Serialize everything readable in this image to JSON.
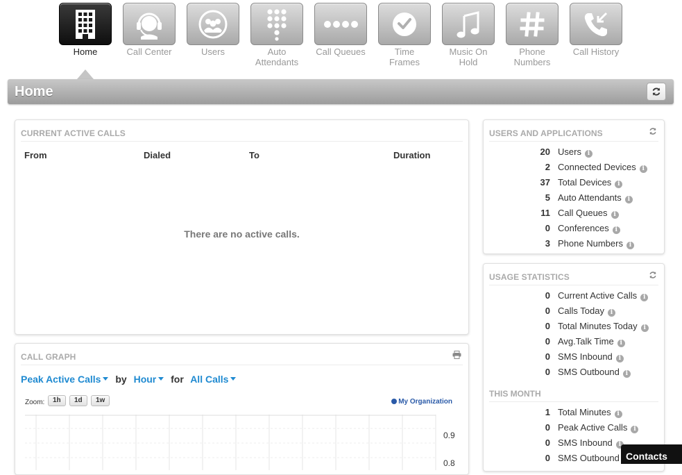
{
  "nav": {
    "items": [
      {
        "label": "Home",
        "icon": "building-icon",
        "active": true
      },
      {
        "label": "Call Center",
        "icon": "headset-icon",
        "active": false
      },
      {
        "label": "Users",
        "icon": "users-icon",
        "active": false
      },
      {
        "label": "Auto Attendants",
        "icon": "keypad-icon",
        "active": false
      },
      {
        "label": "Call Queues",
        "icon": "queue-dots-icon",
        "active": false
      },
      {
        "label": "Time Frames",
        "icon": "clock-icon",
        "active": false
      },
      {
        "label": "Music On Hold",
        "icon": "music-note-icon",
        "active": false
      },
      {
        "label": "Phone Numbers",
        "icon": "hash-icon",
        "active": false
      },
      {
        "label": "Call History",
        "icon": "phone-history-icon",
        "active": false
      }
    ]
  },
  "header": {
    "title": "Home",
    "refresh_icon": "refresh-icon"
  },
  "active_calls": {
    "title": "CURRENT ACTIVE CALLS",
    "columns": [
      "From",
      "Dialed",
      "To",
      "Duration"
    ],
    "empty_message": "There are no active calls."
  },
  "users_apps": {
    "title": "USERS AND APPLICATIONS",
    "rows": [
      {
        "value": "20",
        "label": "Users"
      },
      {
        "value": "2",
        "label": "Connected Devices"
      },
      {
        "value": "37",
        "label": "Total Devices"
      },
      {
        "value": "5",
        "label": "Auto Attendants"
      },
      {
        "value": "11",
        "label": "Call Queues"
      },
      {
        "value": "0",
        "label": "Conferences"
      },
      {
        "value": "3",
        "label": "Phone Numbers"
      }
    ]
  },
  "usage": {
    "title": "USAGE STATISTICS",
    "rows": [
      {
        "value": "0",
        "label": "Current Active Calls"
      },
      {
        "value": "0",
        "label": "Calls Today"
      },
      {
        "value": "0",
        "label": "Total Minutes Today"
      },
      {
        "value": "0",
        "label": "Avg.Talk Time"
      },
      {
        "value": "0",
        "label": "SMS Inbound"
      },
      {
        "value": "0",
        "label": "SMS Outbound"
      }
    ],
    "month_title": "THIS MONTH",
    "month_rows": [
      {
        "value": "1",
        "label": "Total Minutes"
      },
      {
        "value": "0",
        "label": "Peak Active Calls"
      },
      {
        "value": "0",
        "label": "SMS Inbound"
      },
      {
        "value": "0",
        "label": "SMS Outbound"
      }
    ]
  },
  "call_graph": {
    "title": "CALL GRAPH",
    "metric": "Peak Active Calls",
    "by_word": "by",
    "interval": "Hour",
    "for_word": "for",
    "filter": "All Calls",
    "zoom_label": "Zoom:",
    "zoom_options": [
      "1h",
      "1d",
      "1w"
    ],
    "legend": "My Organization",
    "y_ticks": [
      "0.9",
      "0.8"
    ]
  },
  "contacts": {
    "label": "Contacts"
  },
  "colors": {
    "accent": "#1f8ad1",
    "legend": "#2a5aa8",
    "panel_title": "#aaaaaa"
  }
}
